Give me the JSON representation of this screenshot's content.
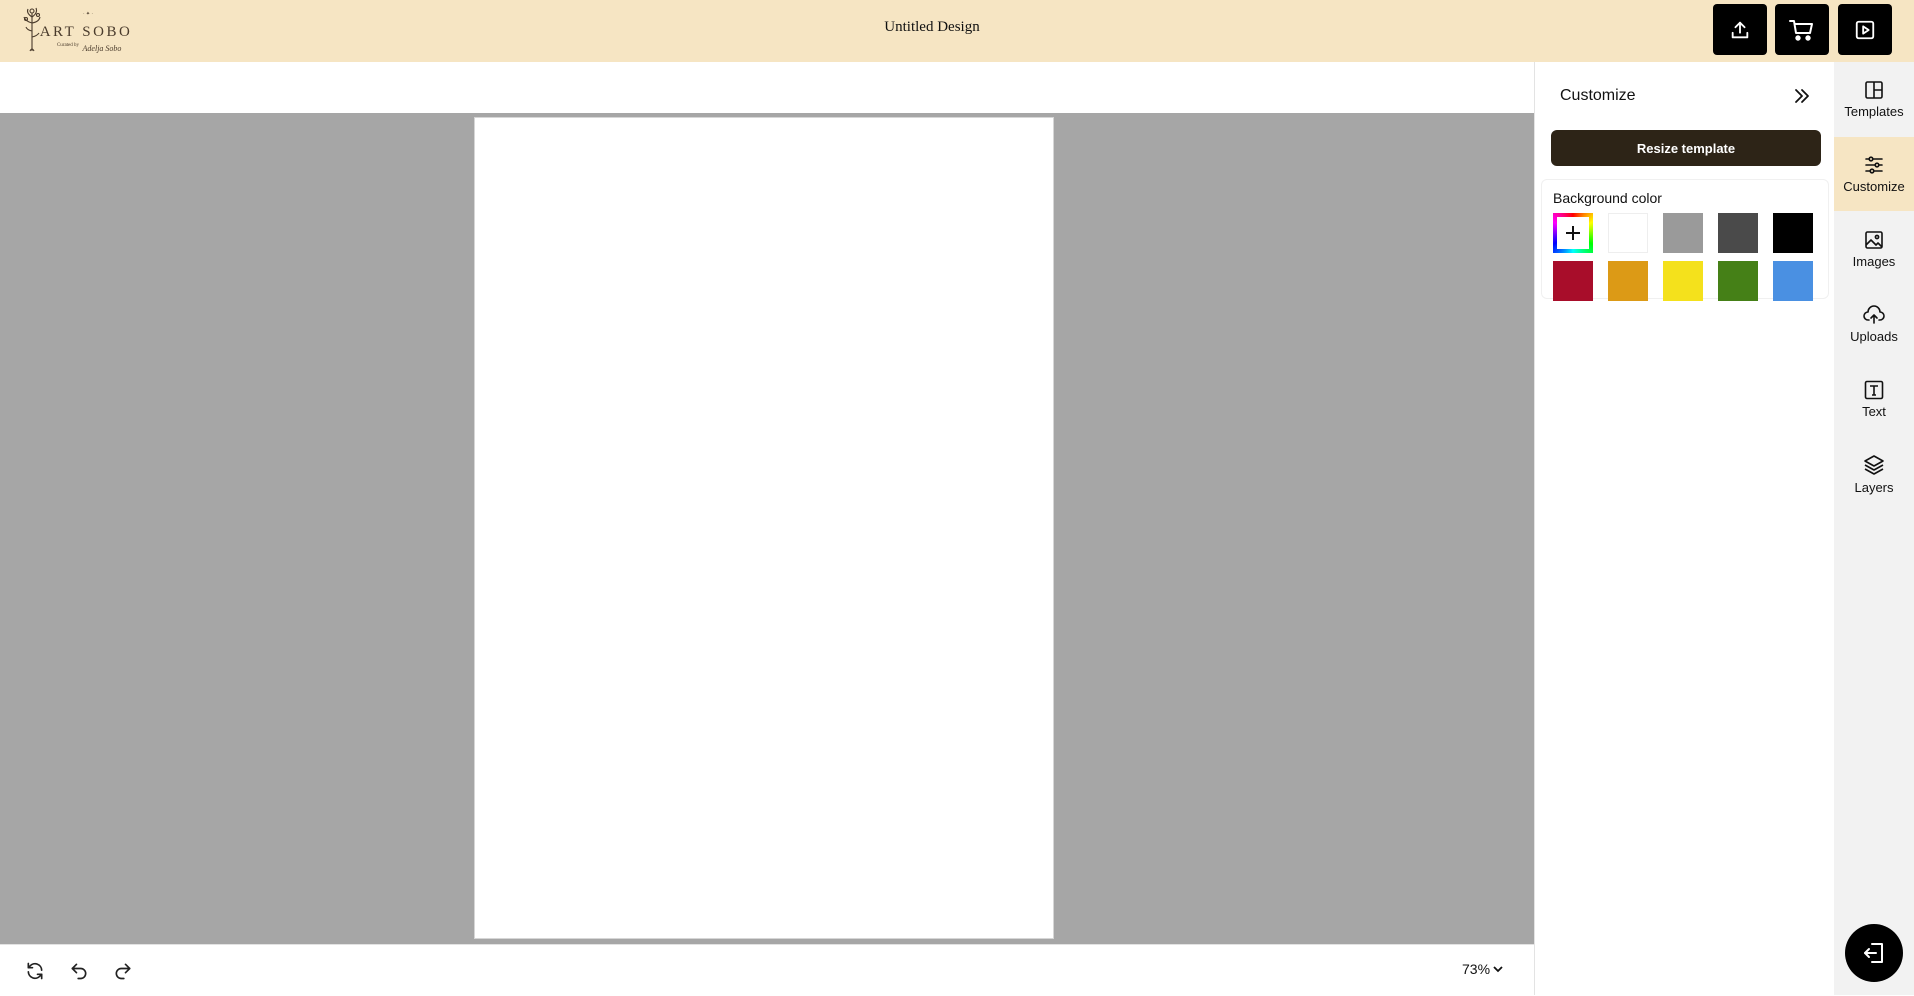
{
  "header": {
    "logo_text": "ART SOBO",
    "logo_small": "Curated by",
    "logo_signature": "Adelja Sobo",
    "title": "Untitled Design",
    "buttons": [
      "upload-icon",
      "cart-icon",
      "play-icon"
    ]
  },
  "canvas": {
    "zoom": "73%"
  },
  "panel": {
    "title": "Customize",
    "resize_label": "Resize template",
    "background_label": "Background color",
    "swatches": [
      "#ffffff",
      "#9a9a9a",
      "#4a4a4a",
      "#000000",
      "#a80d2a",
      "#dc9a16",
      "#f4e11c",
      "#458017",
      "#4a90e2"
    ]
  },
  "rail": {
    "items": [
      {
        "label": "Templates",
        "icon": "templates-icon"
      },
      {
        "label": "Customize",
        "icon": "customize-icon"
      },
      {
        "label": "Images",
        "icon": "images-icon"
      },
      {
        "label": "Uploads",
        "icon": "uploads-icon"
      },
      {
        "label": "Text",
        "icon": "text-icon"
      },
      {
        "label": "Layers",
        "icon": "layers-icon"
      }
    ]
  },
  "colors": {
    "header_bg": "#f6e5c3",
    "workspace_bg": "#a6a6a6",
    "primary_button": "#2d2417",
    "active_tab": "#f6e5c3"
  }
}
